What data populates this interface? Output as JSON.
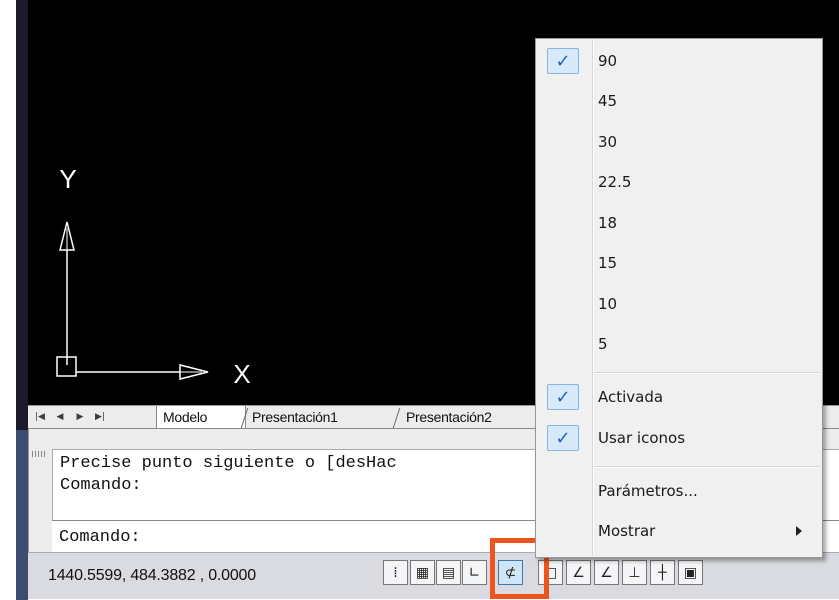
{
  "layout_tabs": {
    "nav": [
      "first",
      "previous",
      "next",
      "last"
    ],
    "items": [
      "Modelo",
      "Presentación1",
      "Presentación2"
    ],
    "active": "Modelo"
  },
  "ucs_icon": {
    "x_label": "X",
    "y_label": "Y"
  },
  "command_window": {
    "history_line1": "Precise punto siguiente o [desHac",
    "history_line2": "Comando:",
    "input_prompt": "Comando:"
  },
  "status_bar": {
    "coordinates": "1440.5599, 484.3882 , 0.0000",
    "buttons": [
      {
        "name": "infer-constraints",
        "glyph": "⁞",
        "on": false
      },
      {
        "name": "snap-mode",
        "glyph": "▦",
        "on": false
      },
      {
        "name": "grid-display",
        "glyph": "▤",
        "on": false
      },
      {
        "name": "ortho-mode",
        "glyph": "∟",
        "on": false
      },
      {
        "name": "polar-tracking",
        "glyph": "⊄",
        "on": true
      },
      {
        "name": "object-snap",
        "glyph": "□",
        "on": false
      },
      {
        "name": "3d-object-snap",
        "glyph": "∠",
        "on": false
      },
      {
        "name": "object-snap-tracking",
        "glyph": "∠",
        "on": false
      },
      {
        "name": "dynamic-ucs",
        "glyph": "⊥",
        "on": false
      },
      {
        "name": "dynamic-input",
        "glyph": "┼",
        "on": false
      },
      {
        "name": "lineweight",
        "glyph": "▣",
        "on": false
      }
    ]
  },
  "context_menu": {
    "angles": [
      {
        "label": "90",
        "checked": true
      },
      {
        "label": "45",
        "checked": false
      },
      {
        "label": "30",
        "checked": false
      },
      {
        "label": "22.5",
        "checked": false
      },
      {
        "label": "18",
        "checked": false
      },
      {
        "label": "15",
        "checked": false
      },
      {
        "label": "10",
        "checked": false
      },
      {
        "label": "5",
        "checked": false
      }
    ],
    "toggles": [
      {
        "label": "Activada",
        "checked": true
      },
      {
        "label": "Usar iconos",
        "checked": true
      }
    ],
    "settings": "Parámetros...",
    "display": "Mostrar",
    "check_glyph": "✓"
  },
  "colors": {
    "viewport_bg": "#000000",
    "highlight": "#f0541e",
    "check": "#1c63c4"
  }
}
